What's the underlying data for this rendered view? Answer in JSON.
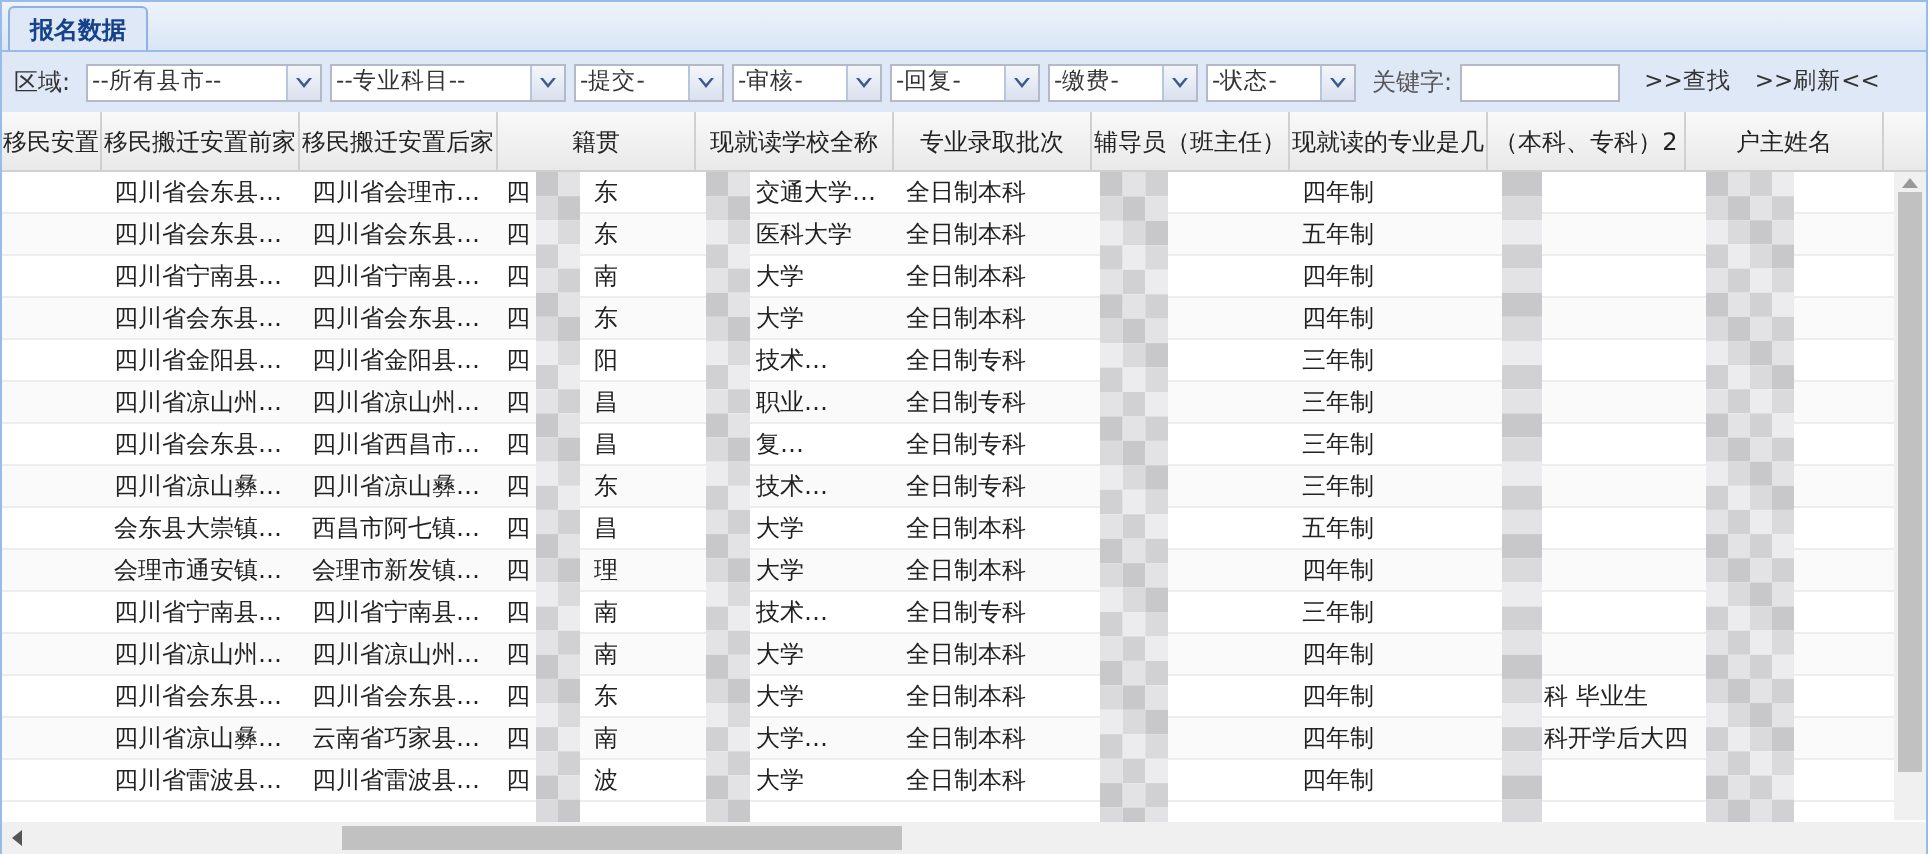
{
  "tabs": [
    {
      "label": "报名数据",
      "selected": true
    }
  ],
  "toolbar": {
    "area_label": "区域:",
    "selects": [
      "--所有县市--",
      "--专业科目--",
      "-提交-",
      "-审核-",
      "-回复-",
      "-缴费-",
      "-状态-"
    ],
    "keyword_label": "关键字:",
    "search_link": ">>查找",
    "refresh_link": ">>刷新<<"
  },
  "table": {
    "columns": [
      "移民安置",
      "移民搬迁安置前家",
      "移民搬迁安置后家",
      "籍贯",
      "现就读学校全称",
      "专业录取批次",
      "辅导员（班主任）",
      "现就读的专业是几",
      "（本科、专科）2",
      "户主姓名"
    ],
    "rows": [
      {
        "before": "四川省会东县…",
        "after": "四川省会理市…",
        "native_head": "四",
        "native_tail": "东",
        "school": "交通大学…",
        "batch": "全日制本科",
        "length": "四年制"
      },
      {
        "before": "四川省会东县…",
        "after": "四川省会东县…",
        "native_head": "四",
        "native_tail": "东",
        "school": "医科大学",
        "batch": "全日制本科",
        "length": "五年制"
      },
      {
        "before": "四川省宁南县…",
        "after": "四川省宁南县…",
        "native_head": "四",
        "native_tail": "南",
        "school": "大学",
        "batch": "全日制本科",
        "length": "四年制"
      },
      {
        "before": "四川省会东县…",
        "after": "四川省会东县…",
        "native_head": "四",
        "native_tail": "东",
        "school": "大学",
        "batch": "全日制本科",
        "length": "四年制"
      },
      {
        "before": "四川省金阳县…",
        "after": "四川省金阳县…",
        "native_head": "四",
        "native_tail": "阳",
        "school": "技术…",
        "batch": "全日制专科",
        "length": "三年制"
      },
      {
        "before": "四川省凉山州…",
        "after": "四川省凉山州…",
        "native_head": "四",
        "native_tail": "昌",
        "school": "职业…",
        "batch": "全日制专科",
        "length": "三年制"
      },
      {
        "before": "四川省会东县…",
        "after": "四川省西昌市…",
        "native_head": "四",
        "native_tail": "昌",
        "school": "复…",
        "batch": "全日制专科",
        "length": "三年制"
      },
      {
        "before": "四川省凉山彝…",
        "after": "四川省凉山彝…",
        "native_head": "四",
        "native_tail": "东",
        "school": "技术…",
        "batch": "全日制专科",
        "length": "三年制"
      },
      {
        "before": "会东县大崇镇…",
        "after": "西昌市阿七镇…",
        "native_head": "四",
        "native_tail": "昌",
        "school": "大学",
        "batch": "全日制本科",
        "length": "五年制"
      },
      {
        "before": "会理市通安镇…",
        "after": "会理市新发镇…",
        "native_head": "四",
        "native_tail": "理",
        "school": "大学",
        "batch": "全日制本科",
        "length": "四年制"
      },
      {
        "before": "四川省宁南县…",
        "after": "四川省宁南县…",
        "native_head": "四",
        "native_tail": "南",
        "school": "技术…",
        "batch": "全日制专科",
        "length": "三年制"
      },
      {
        "before": "四川省凉山州…",
        "after": "四川省凉山州…",
        "native_head": "四",
        "native_tail": "南",
        "school": "大学",
        "batch": "全日制本科",
        "length": "四年制"
      },
      {
        "before": "四川省会东县…",
        "after": "四川省会东县…",
        "native_head": "四",
        "native_tail": "东",
        "school": "大学",
        "batch": "全日制本科",
        "length": "四年制",
        "note": "科 毕业生"
      },
      {
        "before": "四川省凉山彝…",
        "after": "云南省巧家县…",
        "native_head": "四",
        "native_tail": "南",
        "school": "大学…",
        "batch": "全日制本科",
        "length": "四年制",
        "note": "科开学后大四"
      },
      {
        "before": "四川省雷波县…",
        "after": "四川省雷波县…",
        "native_head": "四",
        "native_tail": "波",
        "school": "大学",
        "batch": "全日制本科",
        "length": "四年制"
      }
    ]
  }
}
